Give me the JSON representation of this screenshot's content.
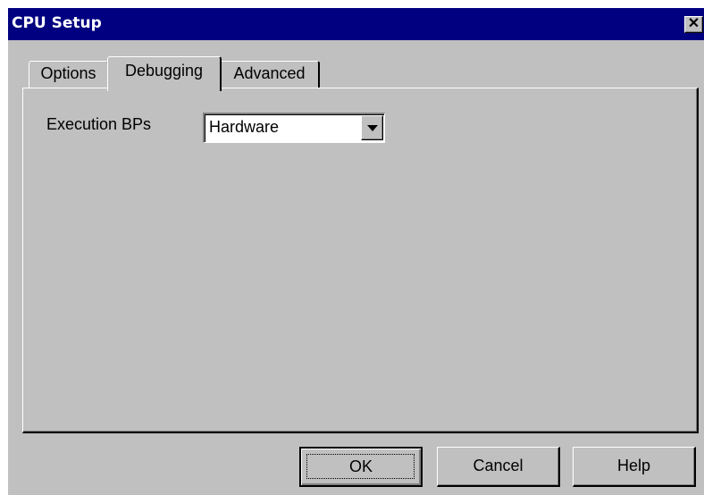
{
  "window": {
    "title": "CPU Setup",
    "close_symbol": "✕",
    "close_icon": "close-icon"
  },
  "tabs": [
    {
      "label": "Options",
      "active": false
    },
    {
      "label": "Debugging",
      "active": true
    },
    {
      "label": "Advanced",
      "active": false
    }
  ],
  "debugging": {
    "execution_bps_label": "Execution BPs",
    "execution_bps_value": "Hardware",
    "dropdown_icon": "chevron-down-icon"
  },
  "buttons": {
    "ok": "OK",
    "cancel": "Cancel",
    "help": "Help"
  },
  "colors": {
    "titlebar": "#000080",
    "face": "#c0c0c0"
  }
}
